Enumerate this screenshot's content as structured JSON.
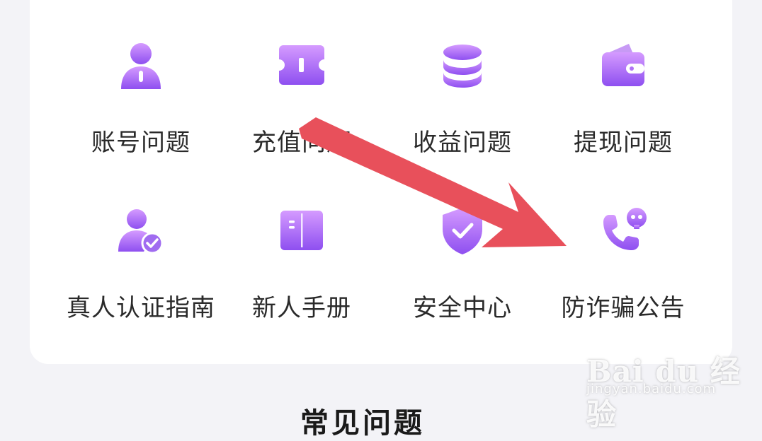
{
  "help_grid": {
    "items": [
      {
        "label": "账号问题",
        "icon": "user-icon"
      },
      {
        "label": "充值问题",
        "icon": "ticket-icon"
      },
      {
        "label": "收益问题",
        "icon": "coin-stack-icon"
      },
      {
        "label": "提现问题",
        "icon": "wallet-icon"
      },
      {
        "label": "真人认证指南",
        "icon": "verified-user-icon"
      },
      {
        "label": "新人手册",
        "icon": "book-icon"
      },
      {
        "label": "安全中心",
        "icon": "shield-check-icon"
      },
      {
        "label": "防诈骗公告",
        "icon": "scam-call-icon"
      }
    ]
  },
  "next_section": {
    "title": "常见问题"
  },
  "annotation": {
    "color": "#e8505b",
    "icon": "red-arrow-pointer"
  },
  "watermark": {
    "brand": "Bai du 经验",
    "url": "jingyan.baidu.com"
  },
  "colors": {
    "accent_from": "#d59bff",
    "accent_to": "#8e4ff0",
    "background": "#f3f3f7",
    "card": "#ffffff"
  }
}
